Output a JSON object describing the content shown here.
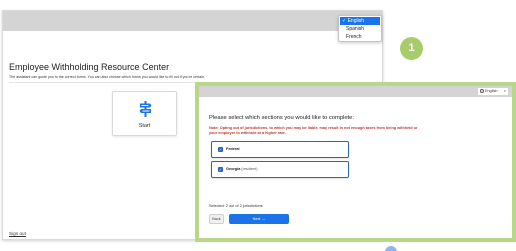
{
  "colors": {
    "accent": "#1a73e8",
    "frame_green": "#b9d68a",
    "badge_green": "#a8cc6c",
    "warning_red": "#c0392b",
    "option_border": "#2b63c4"
  },
  "back_window": {
    "title": "Employee Withholding Resource Center",
    "subtitle": "The assistant can guide you to the correct forms. You can also choose which forms you would like to fill out if you're certain.",
    "start_card": {
      "icon": "signpost-icon",
      "label": "Start"
    },
    "sign_out": "Sign out"
  },
  "language_menu": {
    "options": [
      {
        "label": "English",
        "selected": true,
        "check": "✓"
      },
      {
        "label": "Spanish",
        "selected": false
      },
      {
        "label": "French",
        "selected": false
      }
    ]
  },
  "step_badge": "1",
  "front_window": {
    "language_select": {
      "icon": "globe-icon",
      "value": "English",
      "caret": "∨"
    },
    "question": "Please select which sections you would like to complete:",
    "note": "Note: Opting out of jurisdictions, to which you may be liable, may result in not enough taxes from being withheld or your employer to withhold at a higher rate.",
    "options": [
      {
        "label": "Federal",
        "sub": "",
        "checked": true
      },
      {
        "label": "Georgia",
        "sub": "(resident)",
        "checked": true
      }
    ],
    "selected_count": "Selected: 2 out of 2 jurisdictions",
    "back_label": "Back",
    "next_label": "Next →"
  }
}
